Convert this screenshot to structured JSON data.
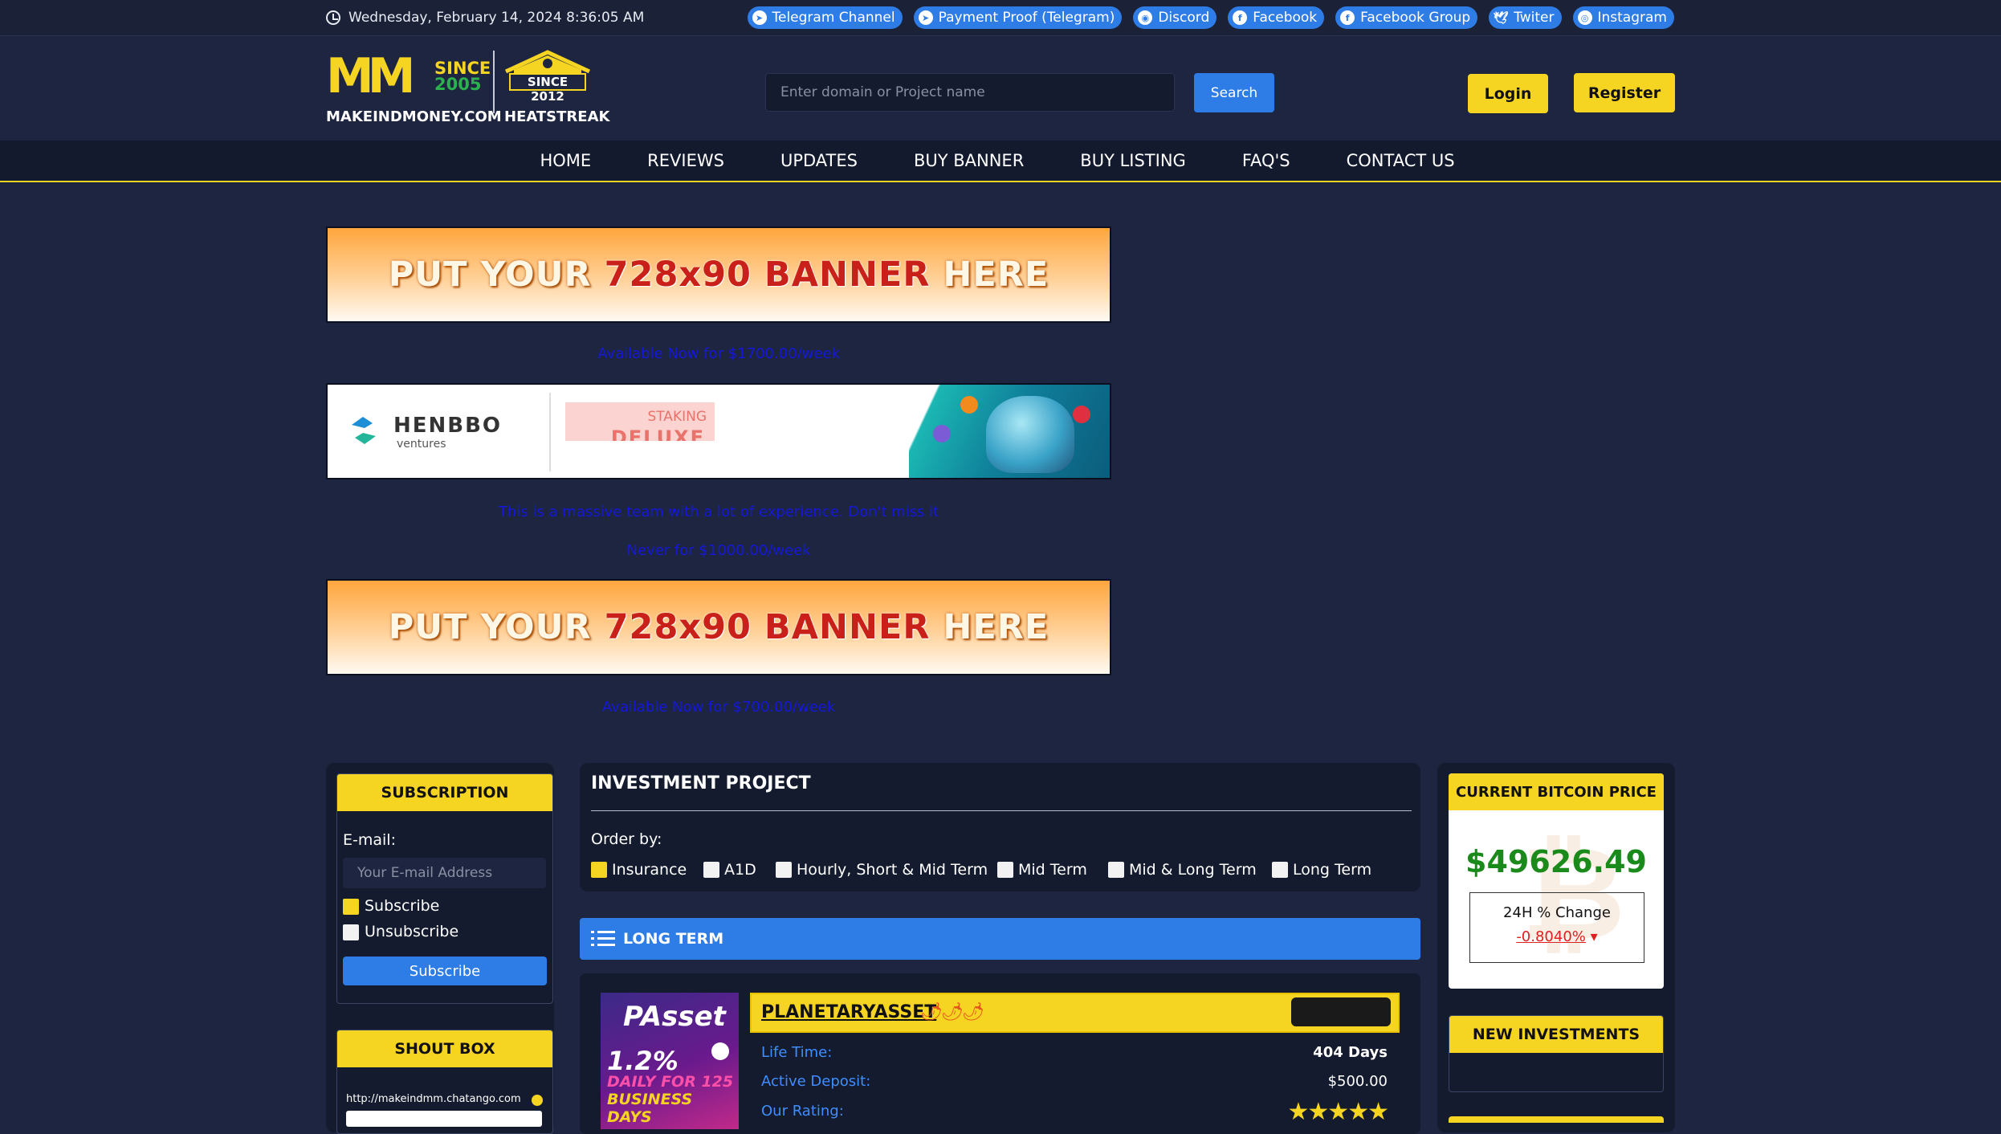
{
  "topbar": {
    "datetime": "Wednesday, February 14, 2024 8:36:05 AM",
    "links": [
      {
        "label": "Telegram Channel",
        "icon": "telegram-icon"
      },
      {
        "label": "Payment Proof (Telegram)",
        "icon": "telegram-icon"
      },
      {
        "label": "Discord",
        "icon": "discord-icon"
      },
      {
        "label": "Facebook",
        "icon": "facebook-icon"
      },
      {
        "label": "Facebook Group",
        "icon": "facebook-icon"
      },
      {
        "label": "Twiter",
        "icon": "twitter-icon"
      },
      {
        "label": "Instagram",
        "icon": "instagram-icon"
      }
    ]
  },
  "header": {
    "logo1": {
      "mark": "MM",
      "since": "SINCE",
      "year": "2005",
      "name": "MAKEINDMONEY.COM"
    },
    "logo2": {
      "since": "SINCE 2012",
      "name": "HEATSTREAK"
    },
    "search_placeholder": "Enter domain or Project name",
    "search_label": "Search",
    "login_label": "Login",
    "register_label": "Register"
  },
  "nav": [
    "HOME",
    "REVIEWS",
    "UPDATES",
    "BUY BANNER",
    "BUY LISTING",
    "FAQ'S",
    "CONTACT US"
  ],
  "banners": {
    "put_parts": [
      "PUT YOUR ",
      "728x90 BANNER",
      " HERE"
    ],
    "caption1": "Available Now for $1700.00/week",
    "henbbo": {
      "name": "HENBBO",
      "sub": "ventures",
      "staking": "STAKING",
      "deluxe": "DELUXE"
    },
    "caption2": "This is a massive team with a lot of experience. Don't miss it",
    "caption3": "Never for $1000.00/week",
    "caption4": "Available Now for $700.00/week"
  },
  "subscription": {
    "title": "SUBSCRIPTION",
    "email_label": "E-mail:",
    "email_placeholder": "Your E-mail Address",
    "subscribe_option": "Subscribe",
    "unsubscribe_option": "Unsubscribe",
    "button": "Subscribe"
  },
  "shoutbox": {
    "title": "SHOUT BOX",
    "url": "http://makeindmm.chatango.com"
  },
  "investment": {
    "title": "INVESTMENT PROJECT",
    "order_by": "Order by:",
    "filters": [
      {
        "label": "Insurance",
        "checked": true
      },
      {
        "label": "A1D",
        "checked": false
      },
      {
        "label": "Hourly, Short & Mid Term",
        "checked": false
      },
      {
        "label": "Mid Term",
        "checked": false
      },
      {
        "label": "Mid & Long Term",
        "checked": false
      },
      {
        "label": "Long Term",
        "checked": false
      }
    ],
    "section": "LONG TERM",
    "project": {
      "name": "PLANETARYASSET",
      "image_brand": "PAsset",
      "image_rate": "1.2%",
      "image_line2": "DAILY FOR 125",
      "image_line3": "BUSINESS DAYS",
      "life_time_label": "Life Time:",
      "life_time": "404 Days",
      "active_deposit_label": "Active Deposit:",
      "active_deposit": "$500.00",
      "rating_label": "Our Rating:",
      "rating_stars": 5
    }
  },
  "bitcoin": {
    "title": "CURRENT BITCOIN PRICE",
    "price": "$49626.49",
    "change_label": "24H % Change",
    "change": "-0.8040%"
  },
  "new_investments": {
    "title": "NEW INVESTMENTS"
  },
  "colors": {
    "accent": "#f5d422",
    "blue": "#2e7ce6",
    "bg": "#1e2540",
    "panel": "#141b2e",
    "price_green": "#1a8a1a",
    "change_red": "#e02020"
  }
}
